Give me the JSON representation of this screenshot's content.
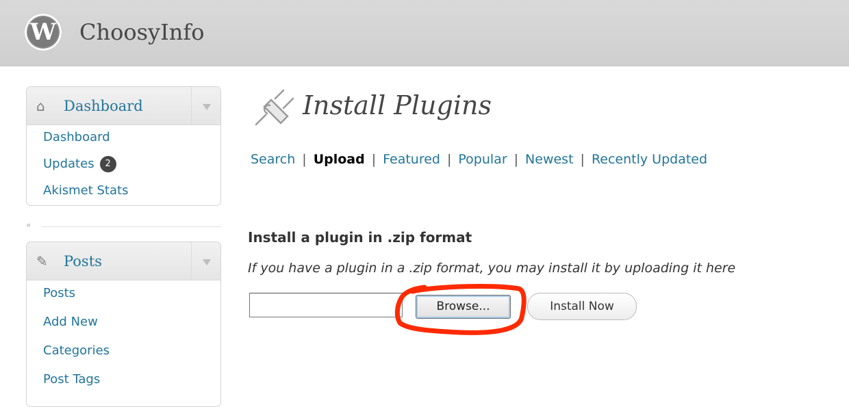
{
  "header": {
    "site_title": "ChoosyInfo",
    "logo_letter": "W"
  },
  "sidebar": {
    "dashboard_menu": {
      "label": "Dashboard",
      "items": [
        {
          "label": "Dashboard"
        },
        {
          "label": "Updates",
          "badge": "2"
        },
        {
          "label": "Akismet Stats"
        }
      ]
    },
    "collapse_glyph": "«",
    "posts_menu": {
      "label": "Posts",
      "items": [
        {
          "label": "Posts"
        },
        {
          "label": "Add New"
        },
        {
          "label": "Categories"
        },
        {
          "label": "Post Tags"
        }
      ]
    }
  },
  "main": {
    "page_title": "Install Plugins",
    "subnav": [
      {
        "label": "Search"
      },
      {
        "label": "Upload",
        "current": true
      },
      {
        "label": "Featured"
      },
      {
        "label": "Popular"
      },
      {
        "label": "Newest"
      },
      {
        "label": "Recently Updated"
      }
    ],
    "upload_heading": "Install a plugin in .zip format",
    "upload_description": "If you have a plugin in a .zip format, you may install it by uploading it here",
    "browse_label": "Browse...",
    "install_label": "Install Now"
  },
  "annotation": {
    "highlight_color": "#ff2a00"
  },
  "colors": {
    "link": "#21759b",
    "header_bg": "#d9d9d9"
  }
}
